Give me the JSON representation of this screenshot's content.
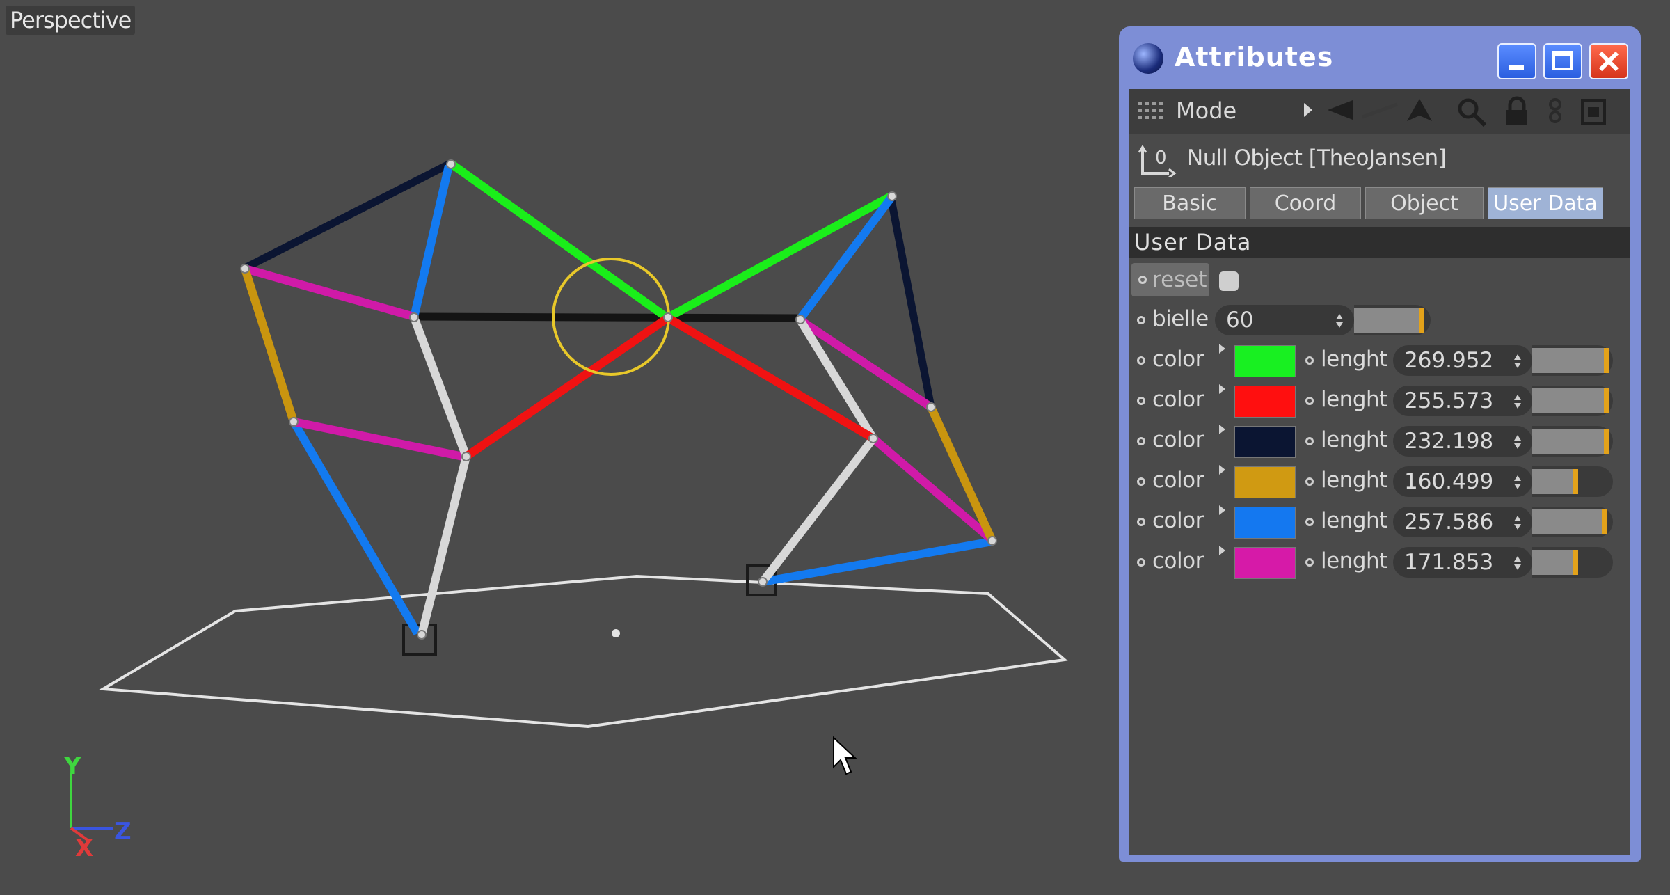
{
  "viewport": {
    "label": "Perspective",
    "axis": {
      "y": "Y",
      "z": "Z",
      "x": "X"
    }
  },
  "attributes": {
    "title": "Attributes",
    "toolbar": {
      "mode_label": "Mode"
    },
    "object_name": "Null Object [TheoJansen]",
    "tabs": [
      {
        "label": "Basic",
        "active": false
      },
      {
        "label": "Coord",
        "active": false
      },
      {
        "label": "Object",
        "active": false
      },
      {
        "label": "User Data",
        "active": true
      }
    ],
    "section_title": "User Data",
    "reset_label": "reset",
    "bielle": {
      "label": "bielle",
      "value": "60",
      "slider_fraction": 0.92
    },
    "rows": [
      {
        "color_label": "color",
        "color": "#18f021",
        "length_label": "lenght",
        "value": "269.952",
        "slider_fraction": 0.95
      },
      {
        "color_label": "color",
        "color": "#ff0f0f",
        "length_label": "lenght",
        "value": "255.573",
        "slider_fraction": 0.95
      },
      {
        "color_label": "color",
        "color": "#0b1532",
        "length_label": "lenght",
        "value": "232.198",
        "slider_fraction": 0.95
      },
      {
        "color_label": "color",
        "color": "#d09a12",
        "length_label": "lenght",
        "value": "160.499",
        "slider_fraction": 0.55
      },
      {
        "color_label": "color",
        "color": "#1478f0",
        "length_label": "lenght",
        "value": "257.586",
        "slider_fraction": 0.93
      },
      {
        "color_label": "color",
        "color": "#d61aa8",
        "length_label": "lenght",
        "value": "171.853",
        "slider_fraction": 0.55
      }
    ]
  },
  "scene_colors": {
    "green": "#1aee1a",
    "red": "#f01212",
    "navy": "#0b1532",
    "gold": "#c9950f",
    "blue": "#137af0",
    "magenta": "#d01aa8",
    "white": "#d8d8d8",
    "black": "#141414",
    "ring": "#e8c82a",
    "floor": "#e4e4e4"
  }
}
